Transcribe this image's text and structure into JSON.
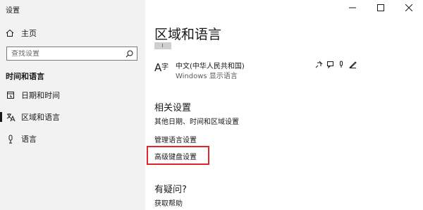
{
  "window": {
    "title": "设置"
  },
  "sidebar": {
    "home_label": "主页",
    "search_placeholder": "查找设置",
    "section_title": "时间和语言",
    "items": [
      {
        "label": "日期和时间",
        "icon": "calendar-icon"
      },
      {
        "label": "区域和语言",
        "icon": "globe-language-icon",
        "active": true
      },
      {
        "label": "语言",
        "icon": "microphone-icon"
      }
    ]
  },
  "main": {
    "title": "区域和语言",
    "language": {
      "name": "中文(中华人民共和国)",
      "sublabel": "Windows 显示语言",
      "feature_icons": [
        "display-icon",
        "speech-icon",
        "microphone-icon",
        "handwriting-icon"
      ]
    },
    "related": {
      "heading": "相关设置",
      "links": [
        "其他日期、时间和区域设置",
        "管理语言设置",
        "高级键盘设置"
      ]
    },
    "help": {
      "heading": "有疑问?",
      "link": "获取帮助"
    }
  },
  "colors": {
    "highlight_border": "#e0262a",
    "sidebar_bg": "#f2f2f2"
  }
}
